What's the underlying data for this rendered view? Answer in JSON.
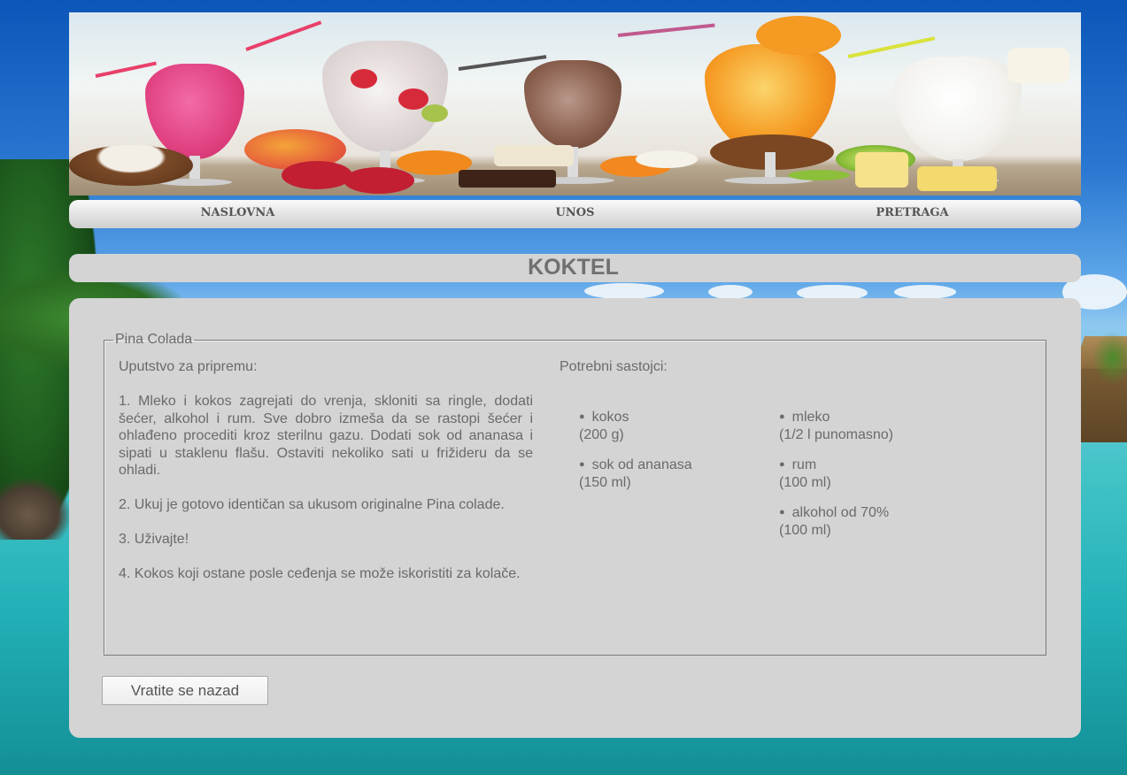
{
  "nav": {
    "items": [
      {
        "label": "NASLOVNA"
      },
      {
        "label": "UNOS"
      },
      {
        "label": "PRETRAGA"
      }
    ]
  },
  "title": "KOKTEL",
  "recipe": {
    "name": "Pina Colada",
    "instructions_heading": "Uputstvo za pripremu:",
    "steps": [
      "1. Mleko i kokos zagrejati do vrenja, skloniti sa ringle, dodati šećer, alkohol i rum. Sve dobro izmeša da se rastopi šećer i ohlađeno procediti kroz sterilnu gazu. Dodati sok od ananasa i sipati u staklenu flašu. Ostaviti nekoliko sati u frižideru da se ohladi.",
      "2. Ukuj je gotovo identičan sa ukusom originalne Pina colade.",
      "3. Uživajte!",
      "4. Kokos koji ostane posle ceđenja se može iskoristiti za kolače."
    ],
    "ingredients_heading": "Potrebni sastojci:",
    "ingredients": [
      {
        "name": "kokos",
        "amount": "(200 g)"
      },
      {
        "name": "mleko",
        "amount": "(1/2 l punomasno)"
      },
      {
        "name": "sok od ananasa",
        "amount": "(150 ml)"
      },
      {
        "name": "rum",
        "amount": "(100 ml)"
      },
      {
        "name": "alkohol od 70%",
        "amount": "(100 ml)"
      }
    ]
  },
  "back_button": "Vratite se nazad",
  "colors": {
    "panel": "#d4d4d4",
    "text": "#6a6a6a",
    "nav_text": "#555555",
    "title_text": "#707070"
  },
  "icons": [
    "bullet-icon"
  ]
}
